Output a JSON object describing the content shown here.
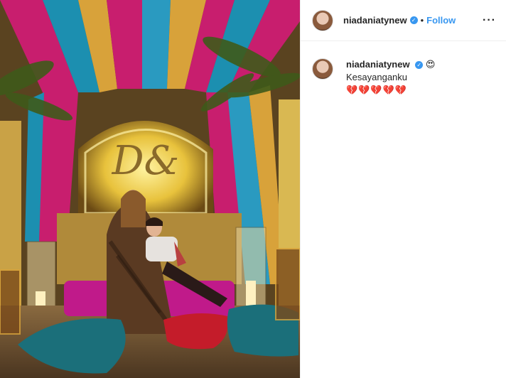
{
  "header": {
    "username": "niadaniatynew",
    "follow_label": "Follow",
    "separator": "•",
    "more_label": "···",
    "verified_glyph": "✓"
  },
  "caption": {
    "username": "niadaniatynew",
    "emoji": "😍",
    "text": "Kesayanganku",
    "hearts": "💔💔💔💔💔"
  },
  "media": {
    "description_icon": "photo",
    "colors": {
      "curtain_pink": "#c81e6e",
      "curtain_teal": "#1c8fb0",
      "curtain_gold": "#d8a23a",
      "arch_glow": "#f3d34a",
      "ottoman": "#c01a8a",
      "pillow_teal": "#1b6f7a",
      "pillow_red": "#c41c2a"
    }
  }
}
